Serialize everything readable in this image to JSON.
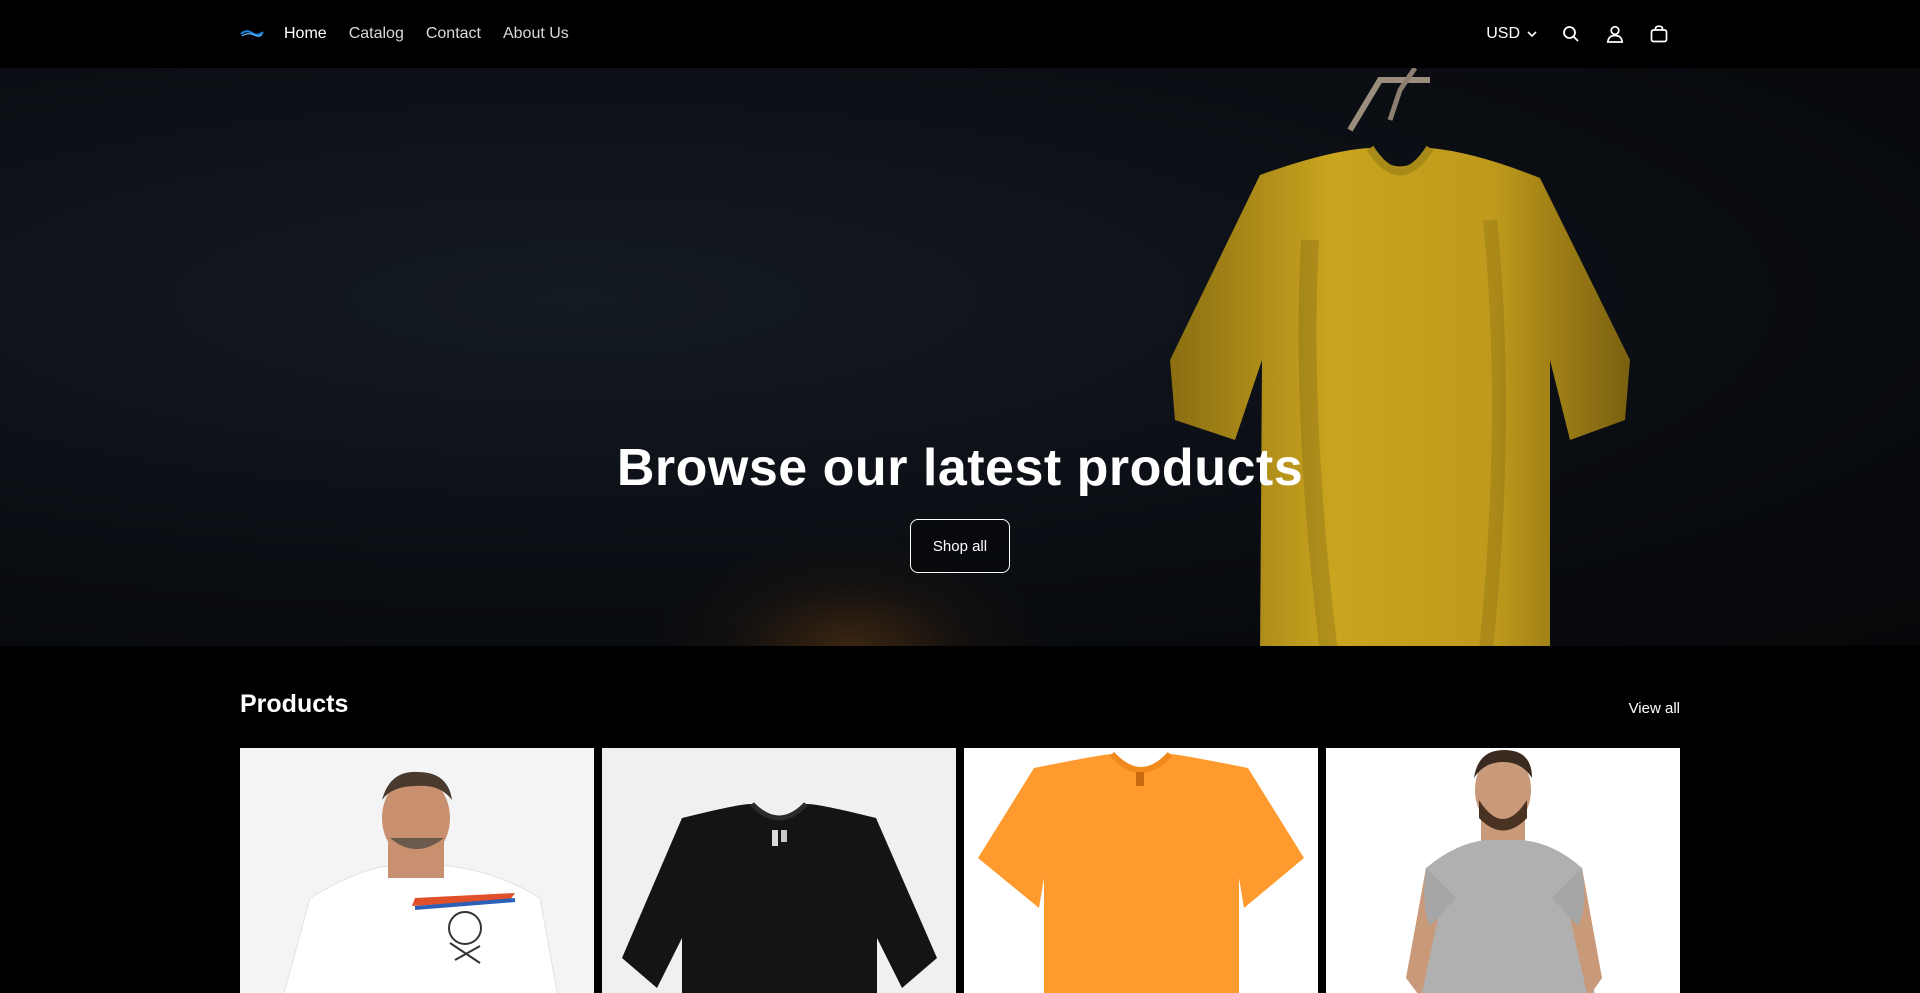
{
  "header": {
    "logo_alt": "Store logo",
    "nav": [
      {
        "label": "Home",
        "active": true
      },
      {
        "label": "Catalog",
        "active": false
      },
      {
        "label": "Contact",
        "active": false
      },
      {
        "label": "About Us",
        "active": false
      }
    ],
    "currency": "USD",
    "icons": [
      "chevron-down-icon",
      "search-icon",
      "account-icon",
      "cart-icon"
    ]
  },
  "hero": {
    "title": "Browse our latest products",
    "button_label": "Shop all",
    "image": "yellow-tshirt-on-hanger"
  },
  "products": {
    "title": "Products",
    "view_all_label": "View all",
    "items": [
      {
        "image": "man-white-hockey-print-tshirt"
      },
      {
        "image": "black-tshirt"
      },
      {
        "image": "orange-tshirt"
      },
      {
        "image": "man-grey-tshirt"
      }
    ]
  },
  "colors": {
    "background": "#000000",
    "accent_logo": "#1e88e5",
    "hero_shirt": "#c9a41f"
  }
}
